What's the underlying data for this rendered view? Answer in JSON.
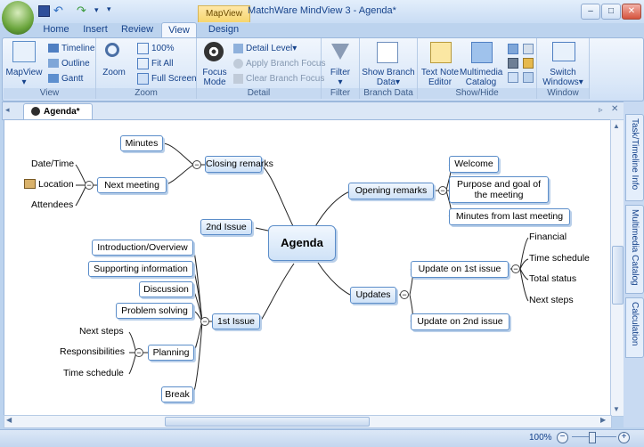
{
  "app": {
    "title": "MatchWare MindView 3 - Agenda*",
    "context_tab": "MapView"
  },
  "window_controls": {
    "minimize": "–",
    "maximize": "□",
    "close": "✕"
  },
  "quick_access": {
    "dropdown": "▾"
  },
  "tabs": [
    "Home",
    "Insert",
    "Review",
    "View",
    "Design"
  ],
  "ribbon": {
    "view": {
      "label": "View",
      "mapview": "MapView",
      "timeline": "Timeline",
      "outline": "Outline",
      "gantt": "Gantt"
    },
    "zoom": {
      "label": "Zoom",
      "zoom": "Zoom",
      "pct": "100%",
      "fit_all": "Fit All",
      "full_screen": "Full Screen"
    },
    "detail": {
      "label": "Detail",
      "focus_mode_1": "Focus",
      "focus_mode_2": "Mode",
      "detail_level": "Detail Level",
      "apply_focus": "Apply Branch Focus",
      "clear_focus": "Clear Branch Focus"
    },
    "filter": {
      "label": "Filter",
      "filter": "Filter"
    },
    "branch_data": {
      "label": "Branch Data",
      "show_1": "Show Branch",
      "show_2": "Data"
    },
    "show_hide": {
      "label": "Show/Hide",
      "text_note_1": "Text Note",
      "text_note_2": "Editor",
      "multimedia_1": "Multimedia",
      "multimedia_2": "Catalog"
    },
    "window": {
      "label": "Window",
      "switch_1": "Switch",
      "switch_2": "Windows"
    }
  },
  "doc_tab": {
    "label": "Agenda*"
  },
  "side_tabs": [
    "Task/Timeline Info",
    "Multimedia Catalog",
    "Calculation"
  ],
  "mindmap": {
    "root": "Agenda",
    "closing_remarks": "Closing remarks",
    "minutes": "Minutes",
    "next_meeting": "Next meeting",
    "date_time": "Date/Time",
    "location": "Location",
    "attendees": "Attendees",
    "second_issue": "2nd Issue",
    "first_issue": "1st Issue",
    "intro": "Introduction/Overview",
    "supporting": "Supporting information",
    "discussion": "Discussion",
    "problem": "Problem solving",
    "planning": "Planning",
    "plan_next": "Next steps",
    "plan_resp": "Responsibilities",
    "plan_time": "Time schedule",
    "break": "Break",
    "opening": "Opening remarks",
    "welcome": "Welcome",
    "purpose_1": "Purpose and goal of",
    "purpose_2": "the meeting",
    "minutes_last": "Minutes from last meeting",
    "updates": "Updates",
    "update1": "Update on 1st issue",
    "update2": "Update on 2nd issue",
    "financial": "Financial",
    "time_schedule": "Time schedule",
    "total_status": "Total status",
    "next_steps": "Next steps"
  },
  "status": {
    "zoom": "100%"
  }
}
